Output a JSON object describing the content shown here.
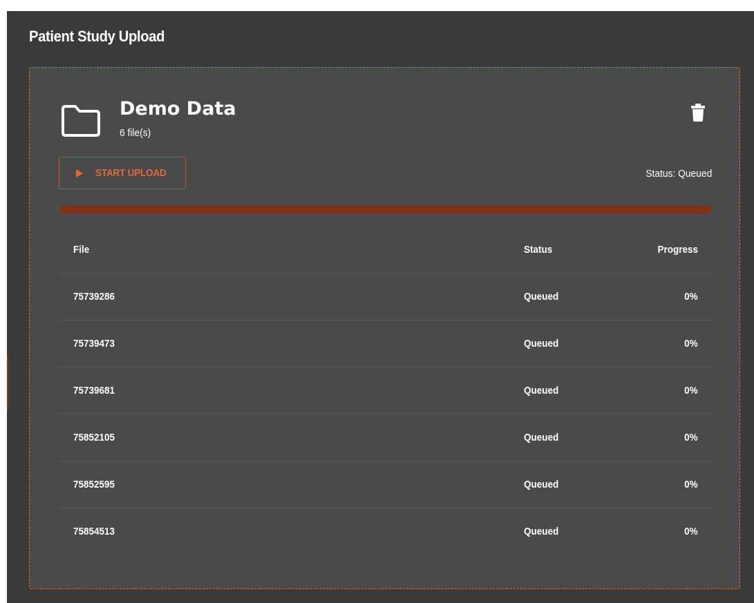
{
  "page": {
    "title": "Patient Study Upload"
  },
  "study": {
    "name": "Demo Data",
    "file_count": "6 file(s)",
    "start_button_label": "START UPLOAD",
    "overall_status": "Status: Queued",
    "overall_progress": 0,
    "folder_icon": "folder-icon",
    "delete_icon": "trash-icon",
    "start_icon": "play-icon"
  },
  "table": {
    "headers": {
      "file": "File",
      "status": "Status",
      "progress": "Progress"
    },
    "rows": [
      {
        "file": "75739286",
        "status": "Queued",
        "progress": "0%"
      },
      {
        "file": "75739473",
        "status": "Queued",
        "progress": "0%"
      },
      {
        "file": "75739681",
        "status": "Queued",
        "progress": "0%"
      },
      {
        "file": "75852105",
        "status": "Queued",
        "progress": "0%"
      },
      {
        "file": "75852595",
        "status": "Queued",
        "progress": "0%"
      },
      {
        "file": "75854513",
        "status": "Queued",
        "progress": "0%"
      }
    ]
  },
  "colors": {
    "background": "#3a3a3a",
    "card": "#4a4a4a",
    "accent": "#e2683a",
    "progress_track": "#7e3517",
    "text": "#ffffff"
  }
}
